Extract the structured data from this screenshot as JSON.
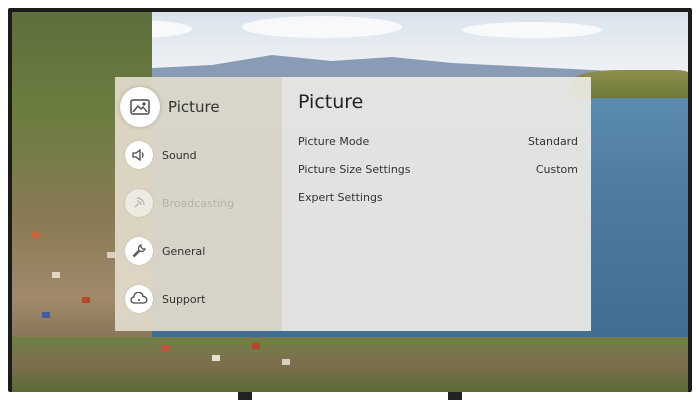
{
  "nav": {
    "items": [
      {
        "label": "Picture",
        "icon": "picture-icon",
        "state": "selected"
      },
      {
        "label": "Sound",
        "icon": "sound-icon",
        "state": "normal"
      },
      {
        "label": "Broadcasting",
        "icon": "broadcasting-icon",
        "state": "disabled"
      },
      {
        "label": "General",
        "icon": "wrench-icon",
        "state": "normal"
      },
      {
        "label": "Support",
        "icon": "support-cloud-icon",
        "state": "normal"
      }
    ]
  },
  "content": {
    "title": "Picture",
    "rows": [
      {
        "label": "Picture Mode",
        "value": "Standard"
      },
      {
        "label": "Picture Size Settings",
        "value": "Custom"
      },
      {
        "label": "Expert Settings",
        "value": ""
      }
    ]
  },
  "colors": {
    "nav_bg": "#e2dacb",
    "content_bg": "#eeece6",
    "text": "#333333",
    "disabled_text": "#b8b2a8"
  }
}
